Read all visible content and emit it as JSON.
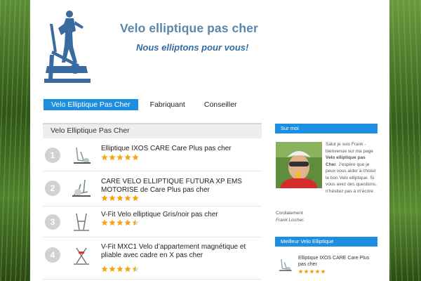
{
  "header": {
    "title": "Velo elliptique pas cher",
    "tagline": "Nous elliptons pour vous!"
  },
  "nav": {
    "items": [
      {
        "label": "Velo Elliptique Pas Cher"
      },
      {
        "label": "Fabriquant"
      },
      {
        "label": "Conseiller"
      }
    ]
  },
  "main": {
    "list_title": "Velo Elliptique Pas Cher",
    "items": [
      {
        "rank": "1",
        "title": "Elliptique IXOS CARE Care Plus pas cher",
        "rating": 5
      },
      {
        "rank": "2",
        "title": "CARE VELO ELLIPTIQUE FUTURA XP EMS MOTORISE de Care Plus pas cher",
        "rating": 5
      },
      {
        "rank": "3",
        "title": "V-Fit Velo elliptique Gris/noir pas cher",
        "rating": 4.5
      },
      {
        "rank": "4",
        "title": "V-Fit MXC1 Velo d’appartement magnétique et pliable avec cadre en X pas cher",
        "rating": 4.5
      }
    ]
  },
  "sidebar": {
    "about": {
      "title": "Sur moi",
      "greeting": "Salut je suis Frank - bienvenue sur ma page",
      "greeting_bold": "Velo elliptique pas Cher",
      "body": ". J'espère que je peux vous aider à choisir le bon Velo elliptique. Si vous avez des questions, n'hésitez pas à m'écrire.",
      "closing": "Cordialement",
      "signature": "Frank Lischer."
    },
    "best": {
      "title": "Meilleur Velo Elliptique",
      "item_title": "Elliptique IXOS CARE Care Plus pas cher",
      "rating": 5
    }
  },
  "colors": {
    "accent": "#1e8fe0",
    "title": "#5a86ad",
    "tagline": "#2f6ca4",
    "star": "#f4a511",
    "badge": "#d2d2d2"
  }
}
